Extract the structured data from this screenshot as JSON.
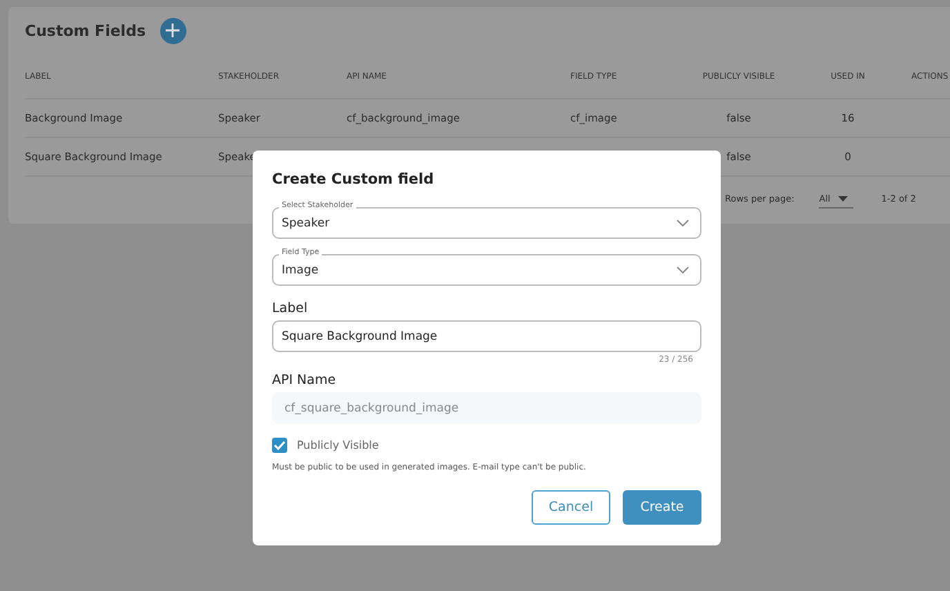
{
  "page": {
    "title": "Custom Fields"
  },
  "table": {
    "columns": [
      "LABEL",
      "STAKEHOLDER",
      "API NAME",
      "FIELD TYPE",
      "PUBLICLY VISIBLE",
      "USED IN",
      "ACTIONS"
    ],
    "rows": [
      [
        "Background Image",
        "Speaker",
        "cf_background_image",
        "cf_image",
        "false",
        "16",
        ""
      ],
      [
        "Square Background Image",
        "Speake",
        "",
        "",
        "false",
        "0",
        ""
      ]
    ]
  },
  "pagination": {
    "rows_per_page_label": "Rows per page:",
    "rows_per_page": "All",
    "range": "1-2 of 2"
  },
  "dialog": {
    "title": "Create Custom field",
    "stakeholder": {
      "label": "Select Stakeholder",
      "value": "Speaker"
    },
    "field_type": {
      "label": "Field Type",
      "value": "Image"
    },
    "label_field": {
      "label": "Label",
      "value": "Square Background Image",
      "counter": "23 / 256"
    },
    "api_name": {
      "label": "API Name",
      "value": "cf_square_background_image"
    },
    "publicly_visible": {
      "label": "Publicly Visible",
      "checked": true,
      "hint": "Must be public to be used in generated images. E-mail type can't be public."
    },
    "buttons": [
      {
        "label": "Cancel",
        "kind": "outline"
      },
      {
        "label": "Create",
        "kind": "primary"
      }
    ]
  }
}
